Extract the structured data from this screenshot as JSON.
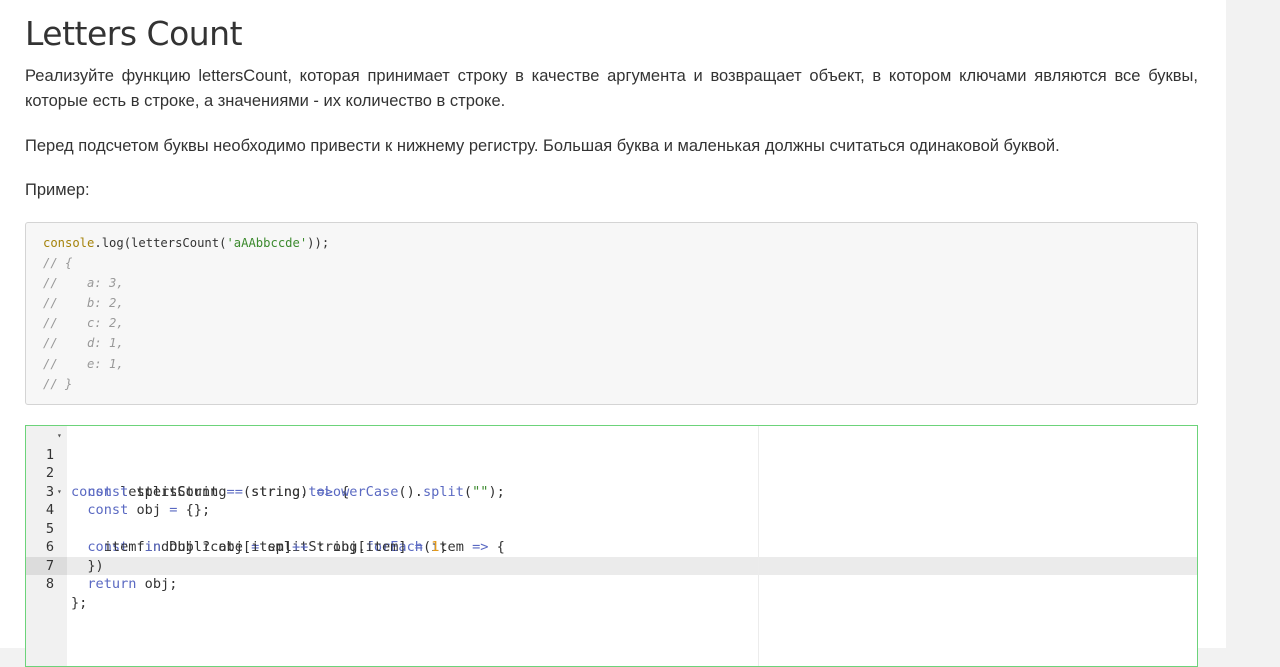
{
  "title": "Letters Count",
  "paragraphs": {
    "p1": "Реализуйте функцию lettersCount, которая принимает строку в качестве аргумента и возвращает объект, в котором ключами являются все буквы, которые есть в строке, а значениями - их количество в строке.",
    "p2": "Перед подсчетом буквы необходимо привести к нижнему регистру. Большая буква и маленькая должны считаться одинаковой буквой.",
    "p3": "Пример:"
  },
  "example": {
    "call_fn": "console",
    "call_rest": ".log(lettersCount(",
    "call_arg": "'aAAbbccde'",
    "call_end": "));",
    "comments": [
      "// {",
      "//    a: 3,",
      "//    b: 2,",
      "//    c: 2,",
      "//    d: 1,",
      "//    e: 1,",
      "// }"
    ]
  },
  "editor": {
    "line_numbers": [
      "1",
      "2",
      "3",
      "4",
      "5",
      "6",
      "7",
      "8"
    ],
    "fold_marker": "▾",
    "active_line": 8,
    "tokens": {
      "const": "const",
      "return": "return",
      "in": "in",
      "l1_a": " lettersCount ",
      "l1_b": "=",
      "l1_c": " (string) ",
      "l1_d": "=>",
      "l1_e": " {",
      "l2_a": " splitString ",
      "l2_b": "=",
      "l2_c": " string.",
      "l2_d": "toLowerCase",
      "l2_e": "().",
      "l2_f": "split",
      "l2_g": "(",
      "l2_h": "\"\"",
      "l2_i": ");",
      "l3_a": " obj ",
      "l3_b": "=",
      "l3_c": " {};",
      "l4_a": " findDublicate ",
      "l4_b": "=",
      "l4_c": " splitString.",
      "l4_d": "forEach",
      "l4_e": "(item ",
      "l4_f": "=>",
      "l4_g": " {",
      "l5_a": "item ",
      "l5_b": " obj ? obj[item]",
      "l5_c": "++",
      "l5_d": " : obj[item] ",
      "l5_e": "=",
      "l5_f": " ",
      "l5_g": "1",
      "l5_h": ";",
      "l6": "})",
      "l7": " obj;",
      "l8": "};"
    }
  }
}
